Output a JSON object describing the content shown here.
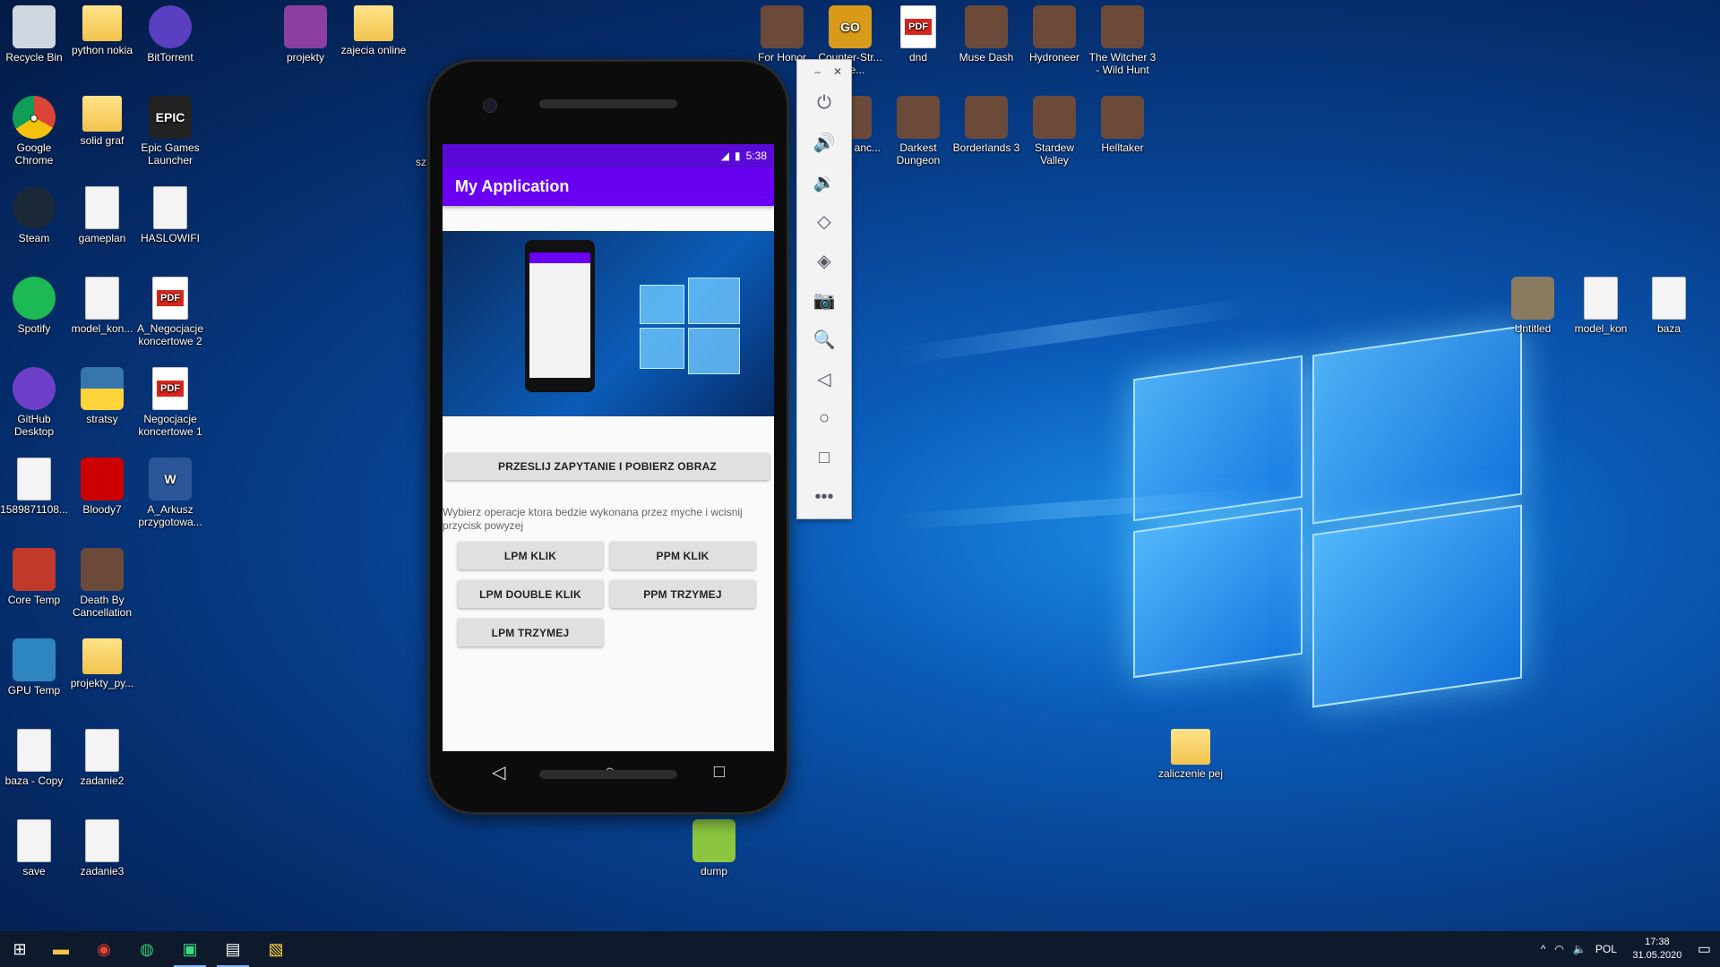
{
  "desktop": {
    "left_icons": [
      {
        "label": "Recycle Bin",
        "icon": "recycle-bin-icon"
      },
      {
        "label": "python nokia",
        "icon": "folder-icon"
      },
      {
        "label": "BitTorrent",
        "icon": "bittorrent-icon"
      },
      {
        "label": "Google Chrome",
        "icon": "chrome-icon"
      },
      {
        "label": "solid graf",
        "icon": "folder-icon"
      },
      {
        "label": "Epic Games Launcher",
        "icon": "epic-games-icon"
      },
      {
        "label": "Steam",
        "icon": "steam-icon"
      },
      {
        "label": "gameplan",
        "icon": "file-icon"
      },
      {
        "label": "HASLOWIFI",
        "icon": "file-icon"
      },
      {
        "label": "Spotify",
        "icon": "spotify-icon"
      },
      {
        "label": "model_kon...",
        "icon": "image-icon"
      },
      {
        "label": "A_Negocjacje koncertowe 2",
        "icon": "pdf-icon"
      },
      {
        "label": "GitHub Desktop",
        "icon": "github-icon"
      },
      {
        "label": "stratsy",
        "icon": "python-icon"
      },
      {
        "label": "Negocjacje koncertowe 1",
        "icon": "pdf-icon"
      },
      {
        "label": "1589871108...",
        "icon": "image-icon"
      },
      {
        "label": "Bloody7",
        "icon": "bloody-icon"
      },
      {
        "label": "A_Arkusz przygotowa...",
        "icon": "word-icon"
      },
      {
        "label": "Core Temp",
        "icon": "coretemp-icon"
      },
      {
        "label": "Death By Cancellation",
        "icon": "game-icon"
      },
      {
        "label": "GPU Temp",
        "icon": "gputemp-icon"
      },
      {
        "label": "projekty_py...",
        "icon": "folder-icon"
      },
      {
        "label": "baza - Copy",
        "icon": "file-icon"
      },
      {
        "label": "zadanie2",
        "icon": "file-icon"
      },
      {
        "label": "save",
        "icon": "file-icon"
      },
      {
        "label": "zadanie3",
        "icon": "file-icon"
      }
    ],
    "top_icons": [
      {
        "label": "projekty",
        "icon": "winrar-icon"
      },
      {
        "label": "zajecia online",
        "icon": "folder-icon"
      },
      {
        "label": "For Honor",
        "icon": "game-icon"
      },
      {
        "label": "Counter-Str... Offe...",
        "icon": "csgo-icon"
      },
      {
        "label": "dnd",
        "icon": "pdf-icon"
      },
      {
        "label": "Muse Dash",
        "icon": "game-icon"
      },
      {
        "label": "Hydroneer",
        "icon": "game-icon"
      },
      {
        "label": "The Witcher 3 - Wild Hunt",
        "icon": "game-icon"
      },
      {
        "label": "s Gate anc...",
        "icon": "game-icon"
      },
      {
        "label": "Darkest Dungeon",
        "icon": "game-icon"
      },
      {
        "label": "Borderlands 3",
        "icon": "game-icon"
      },
      {
        "label": "Stardew Valley",
        "icon": "game-icon"
      },
      {
        "label": "Helltaker",
        "icon": "game-icon"
      }
    ],
    "right_icons": [
      {
        "label": "Untitled",
        "icon": "gimp-icon"
      },
      {
        "label": "model_kon",
        "icon": "image-icon"
      },
      {
        "label": "baza",
        "icon": "file-icon"
      },
      {
        "label": "zaliczenie pej",
        "icon": "folder-icon"
      },
      {
        "label": "dump",
        "icon": "notepadpp-icon"
      }
    ],
    "partial_label": "sz"
  },
  "emulator": {
    "status_time": "5:38",
    "app_title": "My Application",
    "fetch_button": "PRZESLIJ ZAPYTANIE I POBIERZ OBRAZ",
    "hint": "Wybierz operacje ktora bedzie wykonana przez myche i wcisnij przycisk powyzej",
    "buttons": {
      "lpm_click": "LPM KLIK",
      "ppm_click": "PPM KLIK",
      "lpm_double": "LPM DOUBLE KLIK",
      "ppm_hold": "PPM TRZYMEJ",
      "lpm_hold": "LPM TRZYMEJ"
    },
    "toolbar": [
      "power-icon",
      "volume-up-icon",
      "volume-down-icon",
      "rotate-left-icon",
      "rotate-right-icon",
      "camera-icon",
      "zoom-icon",
      "back-icon",
      "home-icon",
      "overview-icon",
      "more-icon"
    ]
  },
  "taskbar": {
    "language": "POL",
    "time": "17:38",
    "date": "31.05.2020"
  }
}
